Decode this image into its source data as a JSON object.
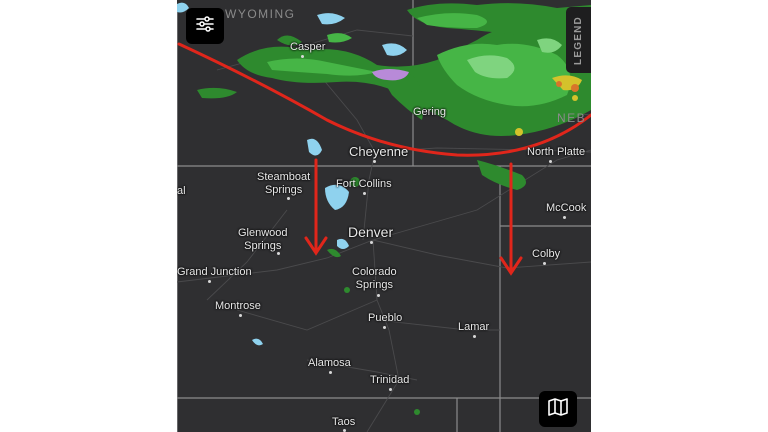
{
  "map": {
    "states": {
      "wyoming": "WYOMING",
      "nebraska": "NEB"
    },
    "cities": [
      {
        "id": "casper",
        "name": "Casper"
      },
      {
        "id": "gering",
        "name": "Gering"
      },
      {
        "id": "cheyenne",
        "name": "Cheyenne"
      },
      {
        "id": "north-platte",
        "name": "North Platte"
      },
      {
        "id": "steamboat-springs",
        "name": "Steamboat\nSprings"
      },
      {
        "id": "fort-collins",
        "name": "Fort Collins"
      },
      {
        "id": "mccook",
        "name": "McCook"
      },
      {
        "id": "glenwood-springs",
        "name": "Glenwood\nSprings"
      },
      {
        "id": "denver",
        "name": "Denver"
      },
      {
        "id": "colby",
        "name": "Colby"
      },
      {
        "id": "grand-junction",
        "name": "Grand Junction"
      },
      {
        "id": "colorado-springs",
        "name": "Colorado\nSprings"
      },
      {
        "id": "montrose",
        "name": "Montrose"
      },
      {
        "id": "pueblo",
        "name": "Pueblo"
      },
      {
        "id": "lamar",
        "name": "Lamar"
      },
      {
        "id": "alamosa",
        "name": "Alamosa"
      },
      {
        "id": "trinidad",
        "name": "Trinidad"
      },
      {
        "id": "taos",
        "name": "Taos"
      },
      {
        "id": "edge-label-al",
        "name": "al"
      }
    ],
    "annotation_color": "#e0261b"
  },
  "controls": {
    "legend_label": "LEGEND",
    "filter_icon": "sliders-icon",
    "map_icon": "map-layers-icon"
  }
}
